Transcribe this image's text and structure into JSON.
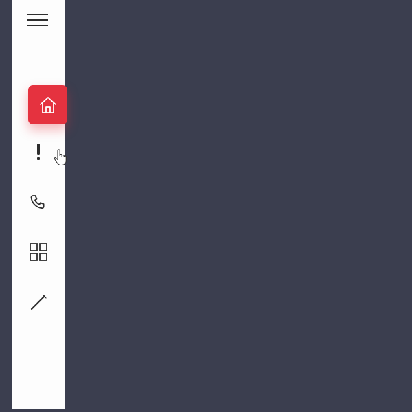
{
  "sidebar": {
    "menu_toggle": {
      "icon": "hamburger-menu-icon"
    },
    "items": [
      {
        "id": "home",
        "icon": "home-icon",
        "active": true
      },
      {
        "id": "alert",
        "icon": "exclamation-icon",
        "active": false
      },
      {
        "id": "phone",
        "icon": "phone-icon",
        "active": false
      },
      {
        "id": "apps",
        "icon": "grid-icon",
        "active": false
      },
      {
        "id": "edit",
        "icon": "pencil-icon",
        "active": false
      }
    ]
  },
  "colors": {
    "background": "#3b3e4f",
    "sidebar": "#fdfdfd",
    "accent": "#e5323f",
    "icon": "#2e2e2e"
  },
  "cursor": {
    "icon": "hand-pointer-icon"
  }
}
